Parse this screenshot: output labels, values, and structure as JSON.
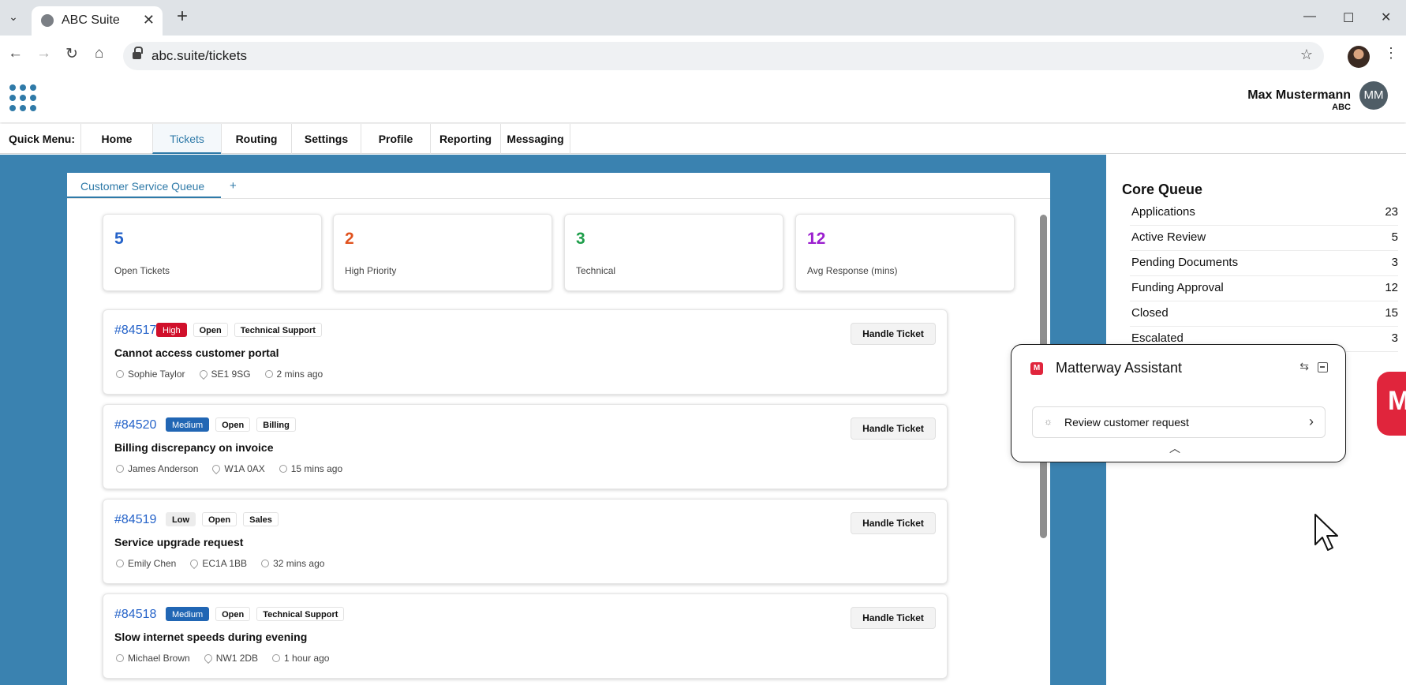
{
  "browser": {
    "tab_title": "ABC Suite",
    "url": "abc.suite/tickets",
    "new_tab": "+",
    "tab_close": "✕"
  },
  "header": {
    "user_name": "Max Mustermann",
    "user_org": "ABC",
    "avatar_initials": "MM"
  },
  "quick_menu": {
    "label": "Quick Menu:",
    "items": [
      "Home",
      "Tickets",
      "Routing",
      "Settings",
      "Profile",
      "Reporting",
      "Messaging"
    ],
    "active": "Tickets"
  },
  "queue_tab": {
    "label": "Customer Service Queue",
    "add": "+"
  },
  "stats": [
    {
      "value": "5",
      "label": "Open Tickets",
      "color": "#2563c9"
    },
    {
      "value": "2",
      "label": "High Priority",
      "color": "#e0531f"
    },
    {
      "value": "3",
      "label": "Technical",
      "color": "#1e9e4a"
    },
    {
      "value": "12",
      "label": "Avg Response (mins)",
      "color": "#9b1fcf"
    }
  ],
  "tickets": [
    {
      "id": "#84517",
      "priority": "High",
      "status": "Open",
      "category": "Technical Support",
      "subject": "Cannot access customer portal",
      "person": "Sophie Taylor",
      "postcode": "SE1 9SG",
      "time": "2 mins ago",
      "action": "Handle Ticket"
    },
    {
      "id": "#84520",
      "priority": "Medium",
      "status": "Open",
      "category": "Billing",
      "subject": "Billing discrepancy on invoice",
      "person": "James Anderson",
      "postcode": "W1A 0AX",
      "time": "15 mins ago",
      "action": "Handle Ticket"
    },
    {
      "id": "#84519",
      "priority": "Low",
      "status": "Open",
      "category": "Sales",
      "subject": "Service upgrade request",
      "person": "Emily Chen",
      "postcode": "EC1A 1BB",
      "time": "32 mins ago",
      "action": "Handle Ticket"
    },
    {
      "id": "#84518",
      "priority": "Medium",
      "status": "Open",
      "category": "Technical Support",
      "subject": "Slow internet speeds during evening",
      "person": "Michael Brown",
      "postcode": "NW1 2DB",
      "time": "1 hour ago",
      "action": "Handle Ticket"
    }
  ],
  "core_queue": {
    "title": "Core Queue",
    "rows": [
      {
        "name": "Applications",
        "count": "23"
      },
      {
        "name": "Active Review",
        "count": "5"
      },
      {
        "name": "Pending Documents",
        "count": "3"
      },
      {
        "name": "Funding Approval",
        "count": "12"
      },
      {
        "name": "Closed",
        "count": "15"
      },
      {
        "name": "Escalated",
        "count": "3"
      }
    ]
  },
  "assistant": {
    "title": "Matterway Assistant",
    "task": "Review customer request",
    "brand_color": "#e0253c"
  },
  "colors": {
    "accent": "#2f7aa8",
    "backdrop": "#3a82b0",
    "high": "#d0102b",
    "medium": "#2166b4"
  }
}
